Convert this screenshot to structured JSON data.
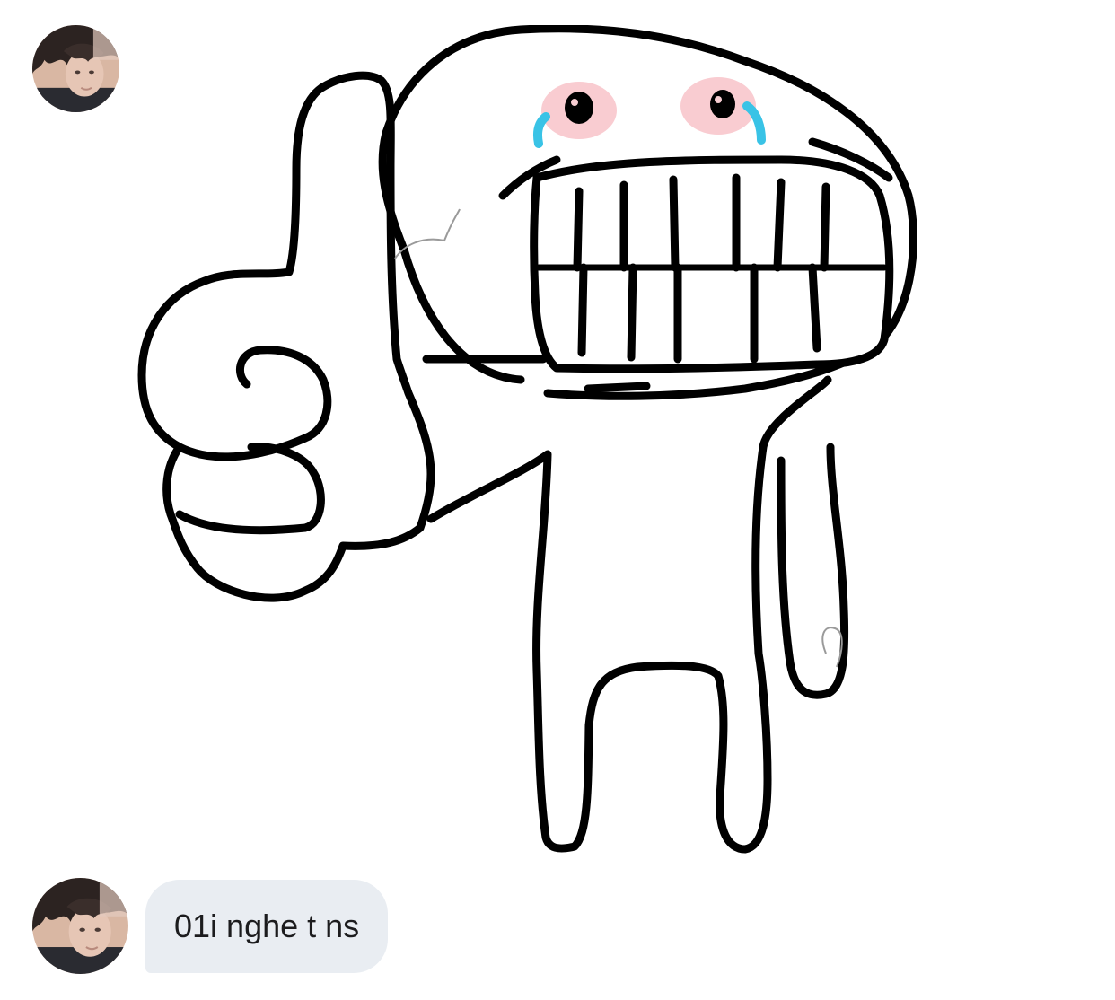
{
  "messages": [
    {
      "type": "sticker",
      "sticker_name": "crying-thumbs-up-stickman"
    },
    {
      "type": "text",
      "text": "01i nghe t ns"
    }
  ],
  "colors": {
    "bubble_background": "#e9edf2",
    "bubble_text": "#1c1c1e",
    "page_background": "#ffffff",
    "tear": "#39c3e6",
    "blush": "#f4a3ab"
  },
  "icons": {
    "avatar": "user-avatar-icon"
  }
}
